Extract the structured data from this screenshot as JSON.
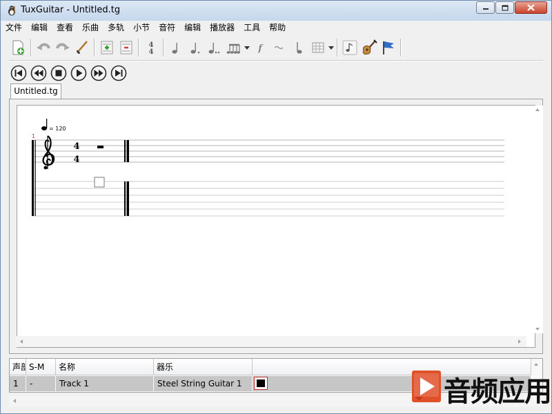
{
  "window": {
    "title": "TuxGuitar - Untitled.tg",
    "controls": {
      "minimize": "minimize-icon",
      "maximize": "maximize-icon",
      "close": "close-icon"
    }
  },
  "menu": [
    "文件",
    "编辑",
    "查看",
    "乐曲",
    "多轨",
    "小节",
    "音符",
    "编辑",
    "播放器",
    "工具",
    "帮助"
  ],
  "toolbar": {
    "icons": [
      "new-file-icon",
      "undo-icon",
      "redo-icon",
      "guitar-pick-icon",
      "add-measure-icon",
      "remove-measure-icon",
      "time-signature-icon",
      "quarter-note-icon",
      "dotted-note-icon",
      "double-dotted-note-icon",
      "tuplet-icon",
      "dynamics-icon",
      "tie-icon",
      "eighth-note-icon",
      "chord-grid-icon",
      "note-icon",
      "guitar-icon",
      "flag-icon"
    ]
  },
  "transport": [
    "first-icon",
    "previous-icon",
    "stop-icon",
    "play-icon",
    "next-icon",
    "last-icon"
  ],
  "tab": {
    "label": "Untitled.tg"
  },
  "score": {
    "measure_number": "1",
    "tempo_text": "= 120",
    "time_signature_top": "4",
    "time_signature_bottom": "4"
  },
  "tracks": {
    "headers": [
      "声部",
      "S-M",
      "名称",
      "器乐"
    ],
    "rows": [
      {
        "number": "1",
        "sm": "-",
        "name": "Track 1",
        "instrument": "Steel String Guitar 1",
        "color": "#000000"
      }
    ]
  },
  "watermark": {
    "text": "音频应用"
  }
}
